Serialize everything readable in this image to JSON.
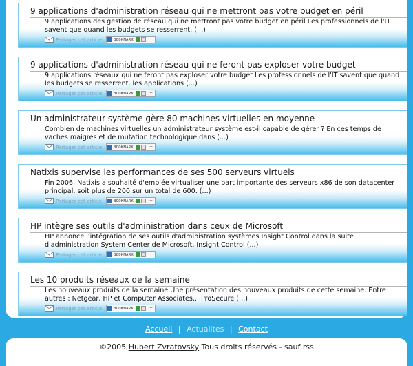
{
  "articles": [
    {
      "title": "9 applications d'administration réseau qui ne mettront pas votre budget en péril",
      "excerpt": "9 applications des gestion de réseau qui ne mettront pas votre budget en péril Les professionnels de l'IT savent que quand les budgets se resserrent, (...)"
    },
    {
      "title": "9 applications d'administration réseau qui ne feront pas exploser votre budget",
      "excerpt": "9 applications réseaux qui ne feront pas exploser votre budget Les professionnels de l'IT savent que quand les budgets se resserrent, les applications (...)"
    },
    {
      "title": "Un administrateur système gère 80 machines virtuelles en moyenne",
      "excerpt": "Combien de machines virtuelles un administrateur système est-il capable de gérer ? En ces temps de vaches maigres et de mutation technologique dans (...)"
    },
    {
      "title": "Natixis supervise les performances de ses 500 serveurs virtuels",
      "excerpt": "Fin 2006, Natixis a souhaité d'emblée virtualiser une part importante des serveurs x86 de son datacenter principal, soit plus de 200 sur un total de 600. (...)"
    },
    {
      "title": "HP intègre ses outils d'administration dans ceux de Microsoft",
      "excerpt": "HP annonce l'intégration de ses outils d'administration systèmes Insight Control dans la suite d'administration System Center de Microsoft. Insight Control (...)"
    },
    {
      "title": "Les 10 produits réseaux de la semaine",
      "excerpt": "Les nouveaux produits de la semaine Une présentation des nouveaux produits de cette semaine. Entre autres : Netgear, HP et Computer Associates... ProSecure (...)"
    }
  ],
  "share": {
    "label": "Partager cet article",
    "bookmark_label": "BOOKMARK",
    "plus": "+",
    "icon": "envelope-icon"
  },
  "nav": {
    "home": "Accueil",
    "news": "Actualites",
    "contact": "Contact",
    "separator": "|"
  },
  "footer": {
    "prefix": "©2005",
    "author": "Hubert Zvratovsky",
    "suffix": "Tous droits réservés - sauf rss"
  },
  "colors": {
    "background": "#2aa9e3",
    "card_gradient_bottom": "#49bdec",
    "card_border": "#7fcbe9"
  }
}
